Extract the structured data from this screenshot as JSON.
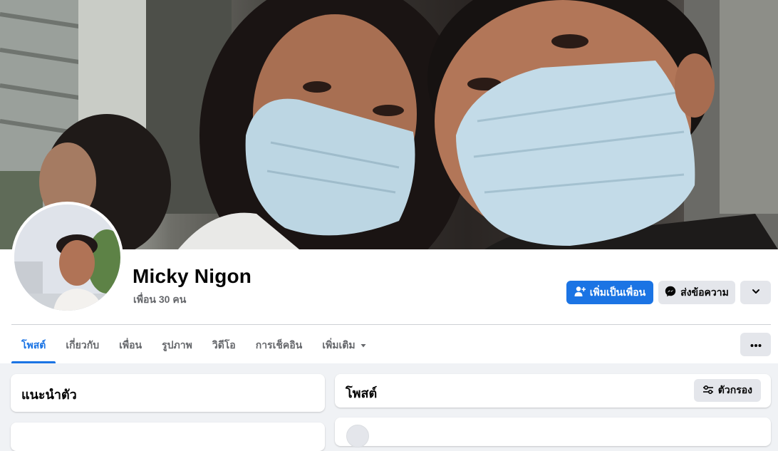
{
  "profile": {
    "name": "Micky Nigon",
    "friend_count": "เพื่อน 30 คน"
  },
  "actions": {
    "add_friend": "เพิ่มเป็นเพื่อน",
    "message": "ส่งข้อความ"
  },
  "tabs": [
    {
      "label": "โพสต์",
      "active": true
    },
    {
      "label": "เกี่ยวกับ",
      "active": false
    },
    {
      "label": "เพื่อน",
      "active": false
    },
    {
      "label": "รูปภาพ",
      "active": false
    },
    {
      "label": "วิดีโอ",
      "active": false
    },
    {
      "label": "การเช็คอิน",
      "active": false
    },
    {
      "label": "เพิ่มเติม",
      "active": false
    }
  ],
  "intro_card": {
    "title": "แนะนำตัว"
  },
  "posts_card": {
    "title": "โพสต์",
    "filter_label": "ตัวกรอง"
  },
  "colors": {
    "accent": "#1b74e4",
    "button_gray": "#e4e6eb",
    "page_bg": "#f0f2f5",
    "secondary_text": "#65676b"
  },
  "icons": {
    "add_friend": "person-plus-icon",
    "message": "messenger-icon",
    "more": "chevron-down-icon",
    "tab_more": "ellipsis-icon",
    "tab_dropdown": "caret-down-icon",
    "filter": "sliders-icon"
  }
}
